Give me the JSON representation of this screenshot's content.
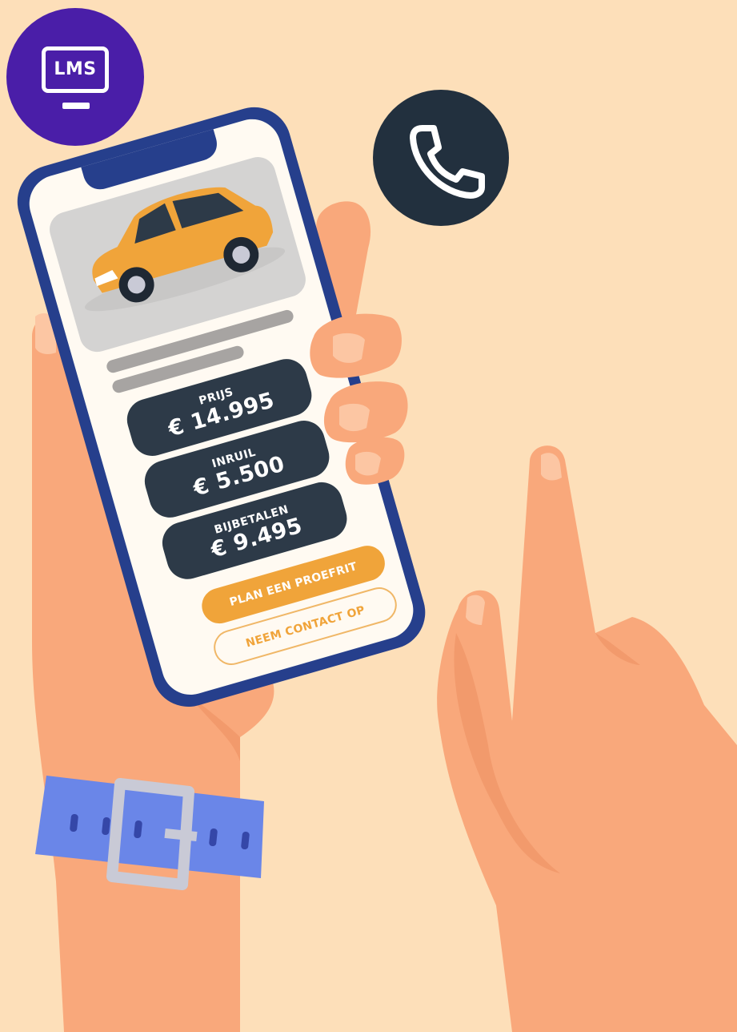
{
  "badges": {
    "lms_text": "LMS",
    "lms_icon": "monitor-icon",
    "phone_icon": "phone-icon"
  },
  "phone_screen": {
    "car_image": "car-icon",
    "cards": [
      {
        "label": "PRIJS",
        "value": "€ 14.995"
      },
      {
        "label": "INRUIL",
        "value": "€ 5.500"
      },
      {
        "label": "BIJBETALEN",
        "value": "€ 9.495"
      }
    ],
    "primary_button": "PLAN EEN PROEFRIT",
    "secondary_button": "NEEM CONTACT OP"
  },
  "colors": {
    "background": "#fddfb9",
    "lms_badge": "#4a1ea8",
    "phone_badge": "#22303e",
    "phone_frame": "#263f8c",
    "card": "#2d3a48",
    "accent": "#f0a43a",
    "skin": "#f9a87b",
    "watch_strap": "#6a86e8"
  }
}
